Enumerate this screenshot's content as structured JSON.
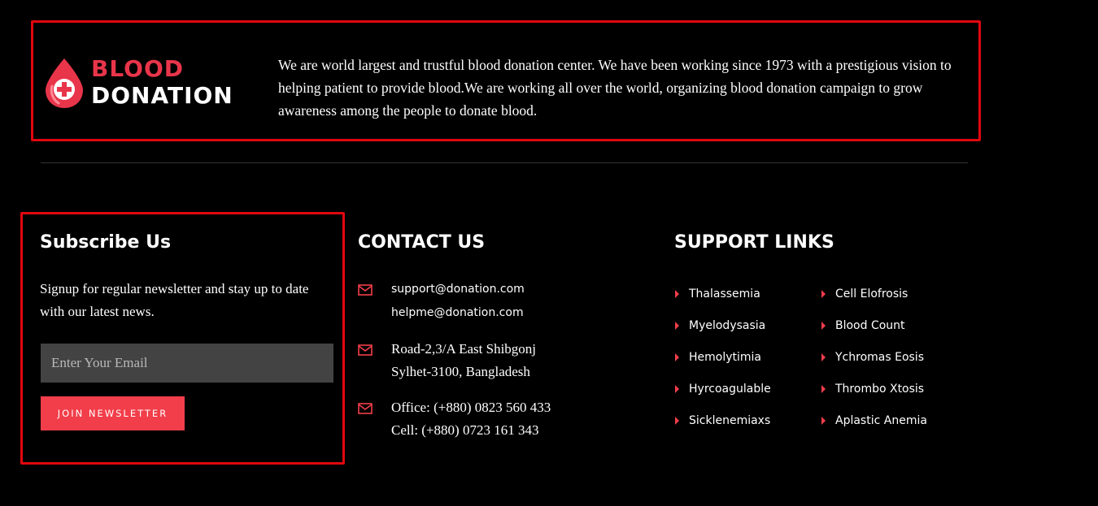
{
  "brand": {
    "line1": "BLOOD",
    "line2": "DONATION",
    "icon": "blood-drop-plus-icon"
  },
  "about": {
    "text": "We are world largest and trustful blood donation center. We have been working since 1973 with a prestigious vision to helping patient to provide blood.We are working all over the world, organizing blood donation campaign to grow awareness among the people to donate blood."
  },
  "subscribe": {
    "title": "Subscribe Us",
    "description": "Signup for regular newsletter and stay up to date with our latest news.",
    "email_placeholder": "Enter Your Email",
    "button_label": "JOIN NEWSLETTER"
  },
  "contact": {
    "title": "CONTACT US",
    "icon": "envelope-icon",
    "emails": [
      "support@donation.com",
      "helpme@donation.com"
    ],
    "address": [
      "Road-2,3/A East Shibgonj",
      "Sylhet-3100, Bangladesh"
    ],
    "phones": [
      "Office:  (+880) 0823 560 433",
      "Cell:  (+880) 0723 161 343"
    ]
  },
  "support": {
    "title": "SUPPORT LINKS",
    "icon": "caret-right-icon",
    "column1": [
      "Thalassemia",
      "Myelodysasia",
      "Hemolytimia",
      "Hyrcoagulable",
      "Sicklenemiaxs"
    ],
    "column2": [
      "Cell Elofrosis",
      "Blood Count",
      "Ychromas Eosis",
      "Thrombo Xtosis",
      "Aplastic Anemia"
    ]
  },
  "colors": {
    "accent": "#f23e4a",
    "highlight_border": "#e1070f",
    "background": "#000000"
  }
}
